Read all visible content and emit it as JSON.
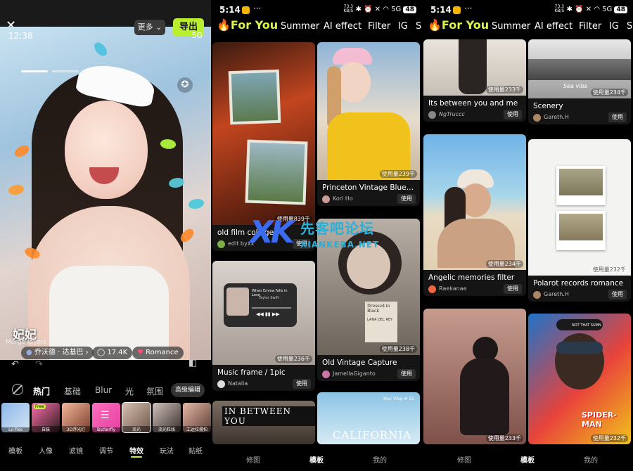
{
  "editor": {
    "close_glyph": "✕",
    "time": "12:38",
    "status": "5G",
    "more_label": "更多 ⌄",
    "export_label": "导出",
    "caption": "妃妃",
    "caption_sub": "Merge layers",
    "music_chip": "乔沃德 · 达基巴 ›",
    "likes_chip": "17.4K",
    "romance_chip": "Romance",
    "categories": [
      "热门",
      "基础",
      "Blur",
      "光",
      "氛围"
    ],
    "advanced_label": "高级编辑",
    "effects": [
      {
        "label": "Lo-fies",
        "tag": ""
      },
      {
        "label": "自装",
        "tag": "Free"
      },
      {
        "label": "3D浮光灯",
        "tag": ""
      },
      {
        "label": "Butterfly",
        "tag": ""
      },
      {
        "label": "流光",
        "tag": ""
      },
      {
        "label": "流光粒线",
        "tag": ""
      },
      {
        "label": "工达拉摆拍",
        "tag": ""
      }
    ],
    "tabs": [
      "模板",
      "人像",
      "滤镜",
      "调节",
      "特效",
      "玩法",
      "贴纸"
    ],
    "active_tab": "特效"
  },
  "statusbar": {
    "time": "5:14",
    "dots": "···",
    "speed_top": "73.3",
    "speed_bottom": "KB/S",
    "signal": "5G",
    "battery": "48"
  },
  "feed_categories": [
    "For You",
    "Summer",
    "AI effect",
    "Filter",
    "IG",
    "S"
  ],
  "feed_categories_3": [
    "For You",
    "Summer",
    "AI effect",
    "Filter",
    "IG",
    "S"
  ],
  "feed1": {
    "cards": [
      {
        "title": "old film collage",
        "author": "edit byxx",
        "usage": "使用量839千",
        "use": "使用"
      },
      {
        "title": "Princeton Vintage Blues ...",
        "author": "Kori Ho",
        "usage": "使用量239千",
        "use": "使用"
      },
      {
        "title": "Music frame / 1pic",
        "author": "Natalia",
        "usage": "使用量236千",
        "use": "使用",
        "overlay_song": "When Emma Falls in Love",
        "overlay_artist": "Taylor Swift"
      },
      {
        "title": "Old Vintage Capture",
        "author": "JamellaGiganto",
        "usage": "使用量238千",
        "use": "使用",
        "overlay_name": "Dressed in Black",
        "overlay_label": "LANA DEL REY"
      },
      {
        "title": "",
        "author": "",
        "usage": "",
        "use": "",
        "overlay_text": "IN BETWEEN YOU"
      },
      {
        "title": "",
        "author": "",
        "usage": "",
        "use": "",
        "overlay_text": "CALIFORNIA",
        "overlay_small": "Your Vlog # 21"
      }
    ]
  },
  "feed2": {
    "cards": [
      {
        "title": "Its between you and me",
        "author": "NgTruccc",
        "usage": "使用量233千",
        "use": "使用"
      },
      {
        "title": "Scenery",
        "author": "Gareth.H",
        "usage": "使用量234千",
        "use": "使用",
        "overlay_text": "Sea vibe"
      },
      {
        "title": "Angelic memories filter",
        "author": "Raekanae",
        "usage": "使用量234千",
        "use": "使用"
      },
      {
        "title": "Polarot records romance",
        "author": "Gareth.H",
        "usage": "使用量232千",
        "use": "使用"
      },
      {
        "title": "",
        "author": "",
        "usage": "使用量233千",
        "use": ""
      },
      {
        "title": "",
        "author": "",
        "usage": "使用量232千",
        "use": "",
        "overlay_text": "SPIDER-MAN",
        "overlay_small": "NOT THAT SUMN"
      }
    ]
  },
  "bottom_nav": [
    "修图",
    "模板",
    "我的"
  ],
  "active_nav": "模板",
  "watermark": {
    "mark": "XK",
    "cn": "先客吧论坛",
    "en": "XIANKEBA.NET"
  },
  "colors": {
    "accent": "#c8f33a",
    "for_you": "#d9f545",
    "fire": "#ff6a1a",
    "export": "#b8f030"
  }
}
